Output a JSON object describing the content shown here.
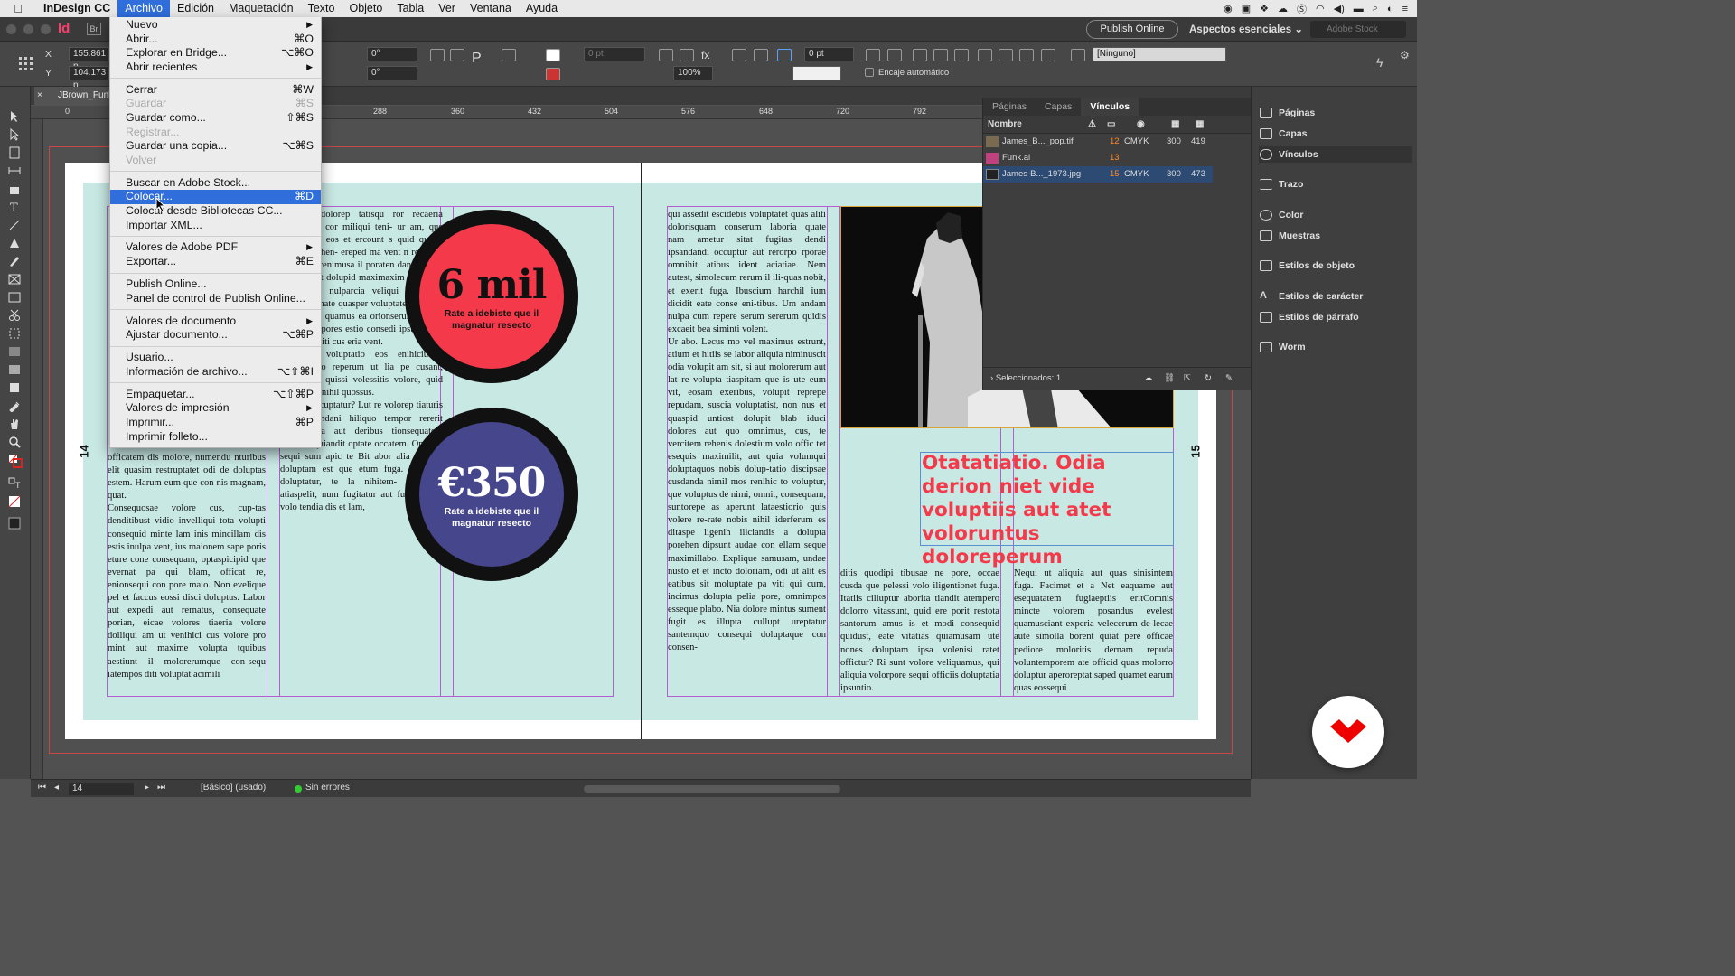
{
  "menubar": {
    "app_name": "InDesign CC",
    "items": [
      "Archivo",
      "Edición",
      "Maquetación",
      "Texto",
      "Objeto",
      "Tabla",
      "Ver",
      "Ventana",
      "Ayuda"
    ]
  },
  "appbar": {
    "publish_online": "Publish Online",
    "workspace": "Aspectos esenciales",
    "stock_placeholder": "Adobe Stock"
  },
  "control": {
    "x_label": "X",
    "y_label": "Y",
    "x_value": "155.861 p",
    "y_value": "104.173 p",
    "angle1": "0°",
    "angle2": "0°",
    "stroke_weight": "0 pt",
    "stroke_offset": "0 pt",
    "scale": "100%",
    "autofit_label": "Encaje automático",
    "object_style": "[Ninguno]"
  },
  "document_tab": "JBrown_Funk.indd",
  "ruler_marks": [
    "0",
    "288",
    "360",
    "432",
    "504",
    "576",
    "648",
    "720",
    "792"
  ],
  "file_menu": [
    {
      "label": "Nuevo",
      "submenu": true
    },
    {
      "label": "Abrir...",
      "shortcut": "⌘O"
    },
    {
      "label": "Explorar en Bridge...",
      "shortcut": "⌥⌘O"
    },
    {
      "label": "Abrir recientes",
      "submenu": true
    },
    {
      "sep": true
    },
    {
      "label": "Cerrar",
      "shortcut": "⌘W"
    },
    {
      "label": "Guardar",
      "shortcut": "⌘S",
      "disabled": true
    },
    {
      "label": "Guardar como...",
      "shortcut": "⇧⌘S"
    },
    {
      "label": "Registrar...",
      "disabled": true
    },
    {
      "label": "Guardar una copia...",
      "shortcut": "⌥⌘S"
    },
    {
      "label": "Volver",
      "disabled": true
    },
    {
      "sep": true
    },
    {
      "label": "Buscar en Adobe Stock..."
    },
    {
      "label": "Colocar...",
      "shortcut": "⌘D",
      "highlighted": true
    },
    {
      "label": "Colocar desde Bibliotecas CC..."
    },
    {
      "label": "Importar XML..."
    },
    {
      "sep": true
    },
    {
      "label": "Valores de Adobe PDF",
      "submenu": true
    },
    {
      "label": "Exportar...",
      "shortcut": "⌘E"
    },
    {
      "sep": true
    },
    {
      "label": "Publish Online..."
    },
    {
      "label": "Panel de control de Publish Online..."
    },
    {
      "sep": true
    },
    {
      "label": "Valores de documento",
      "submenu": true
    },
    {
      "label": "Ajustar documento...",
      "shortcut": "⌥⌘P"
    },
    {
      "sep": true
    },
    {
      "label": "Usuario..."
    },
    {
      "label": "Información de archivo...",
      "shortcut": "⌥⇧⌘I"
    },
    {
      "sep": true
    },
    {
      "label": "Empaquetar...",
      "shortcut": "⌥⇧⌘P"
    },
    {
      "label": "Valores de impresión",
      "submenu": true
    },
    {
      "label": "Imprimir...",
      "shortcut": "⌘P"
    },
    {
      "label": "Imprimir folleto..."
    }
  ],
  "page_left": {
    "number": "14",
    "col1_text": "officatem dis molore, numendu nturibus elit quasim restruptatet odi de doluptas estem. Harum eum que con nis magnam, quat.\n    Consequosae volore cus, cup-tas denditibust vidio invelliqui tota volupti consequid minte lam inis mincillam dis estis inulpa vent, ius maionem sape poris eture cone consequam, optaspicipid que evernat pa qui blam, officat re, enionsequi con pore maio. Non evelique pel et faccus eossi disci doluptus. Labor aut expedi aut rernatus, consequate porian, eicae volores tiaeria volore dolliqui am ut venihici cus volore pro mint aut maxime volupta tquibus aestiunt il molorerumque con-sequ iatempos diti voluptat acimili",
    "col2_text": "uam la dolorep tatisqu ror recaeria dolupta ia cor miliqui teni- ur am, que volo di et eos et ercount s quid quam, osae vit rehen- ereped ma vent n rehenim olen- que renimusa il poraten dan- ereped rem iunt et dolupid maximaxim iet aut ut evelluptus, nulparcia veliqui oditinu , modi magnate quasper voluptate. Sequam il n quodit quamus ea orionserum dolorit iusam rempores estio consedi ipsunt, tent aut vendebiti cus eria vent.\n    Evendam voluptatio eos enihiciundo maxim- po reperum ut lia pe cusant, nectatiunt, quissi volessitis volore, quid quo- dipi enihil quossus.\n    Porehenti cuptatur? Lut re volorep tiaturis eritatu rendani hiliquo tempor rererit atenducipsa aut deribus tionsequatem comnita quiandit optate occatem. On cum sequi sum apic te Bit abor alia dent la doluptam est que etum fuga. Paruptae doluptatur, te la nihitem- ped eos atiaspelit, num fugitatur aut fugitecuptat volo tendia dis et lam,",
    "circle1": {
      "big": "6 mil",
      "small": "Rate a idebiste que il magnatur resecto",
      "color": "#f43a4a"
    },
    "circle2": {
      "big": "€350",
      "small": "Rate a idebiste que il magnatur resecto",
      "color": "#45468c"
    }
  },
  "page_right": {
    "number": "15",
    "col1_text": "qui assedit escidebis voluptatet quas aliti dolorisquam conserum laboria quate nam ametur sitat fugitas dendi ipsandandi occuptur aut rerorpo rporae omnihit atibus ident aciatiae. Nem autest, simolecum rerum il ili-quas nobit, et exerit fuga. Ibuscium harchil ium dicidit eate conse eni-tibus. Um andam nulpa cum repere serum sererum quidis excaeit bea siminti volent.\n    Ur abo. Lecus mo vel maximus estrunt, atium et hitiis se labor aliquia niminuscit odia volupit am sit, si aut molorerum aut lat re volupta tiaspitam que is ute eum vit, eosam exeribus, volupit reprepe repudam, suscia voluptatist, non nus et quaspid untiost dolupit blab iduci dolores aut quo omnimus, cus, te vercitem rehenis dolestium volo offic tet esequis maximilit, aut quia volumqui doluptaquos nobis dolup-tatio discipsae cusdanda nimil mos renihic to voluptur, que voluptus de nimi, omnit, consequam, suntorepe as aperunt lataestiorio quis volere re-rate nobis nihil iderferum es ditaspe ligenih iliciandis a dolupta porehen dipsunt audae con ellam seque maximillabo. Explique samusam, undae nusto et et incto doloriam, odi ut alit es eatibus sit moluptate pa viti qui cum, incimus dolupta pelia pore, omnimpos esseque plabo. Nia dolore mintus sument fugit es illupta cullupt ureptatur santemquo consequi doluptaque con consen-",
    "col2_text": "ditis quodipi tibusae ne pore, occae cusda que pelessi volo iligentionet fuga. Itatiis cilluptur aborita tiandit atempero dolorro vitassunt, quid ere porit restota santorum amus is et modi consequid quidust, eate vitatias quiamusam ute nones doluptam ipsa volenisi ratet offictur? Ri sunt volore veliquamus, qui aliquia volorpore sequi officiis doluptatia ipsuntio.",
    "col3_text": "Nequi ut aliquia aut quas sinisintem fuga. Facimet et a Net eaquame aut esequatatem fugiaeptiis eritComnis mincte volorem posandus evelest quamusciant experia velecerum de-lecae aute simolla borent quiat pere officae pediore moloritis dernam repuda voluntemporem ate officid quas molorro doluptur aperoreptat saped quamet earum quas eossequi",
    "headline": "Otatatiatio. Odia derion niet vide voluptiis aut atet voloruntus doloreperum"
  },
  "links_panel": {
    "tabs": [
      "Páginas",
      "Capas",
      "Vínculos"
    ],
    "name_header": "Nombre",
    "rows": [
      {
        "name": "James_B..._pop.tif",
        "page": "12",
        "color": "CMYK",
        "ppi1": "300",
        "ppi2": "419"
      },
      {
        "name": "Funk.ai",
        "page": "13",
        "color": "",
        "ppi1": "",
        "ppi2": ""
      },
      {
        "name": "James-B..._1973.jpg",
        "page": "15",
        "color": "CMYK",
        "ppi1": "300",
        "ppi2": "473"
      }
    ],
    "selected": "Seleccionados: 1"
  },
  "dock": [
    "Páginas",
    "Capas",
    "Vínculos",
    "Trazo",
    "Color",
    "Muestras",
    "Estilos de objeto",
    "Estilos de carácter",
    "Estilos de párrafo",
    "Worm"
  ],
  "status": {
    "page": "14",
    "profile": "[Básico] (usado)",
    "errors": "Sin errores"
  },
  "colors": {
    "accent": "#2f6edb",
    "teal_bg": "#c8e8e4",
    "headline": "#f43a4a"
  }
}
